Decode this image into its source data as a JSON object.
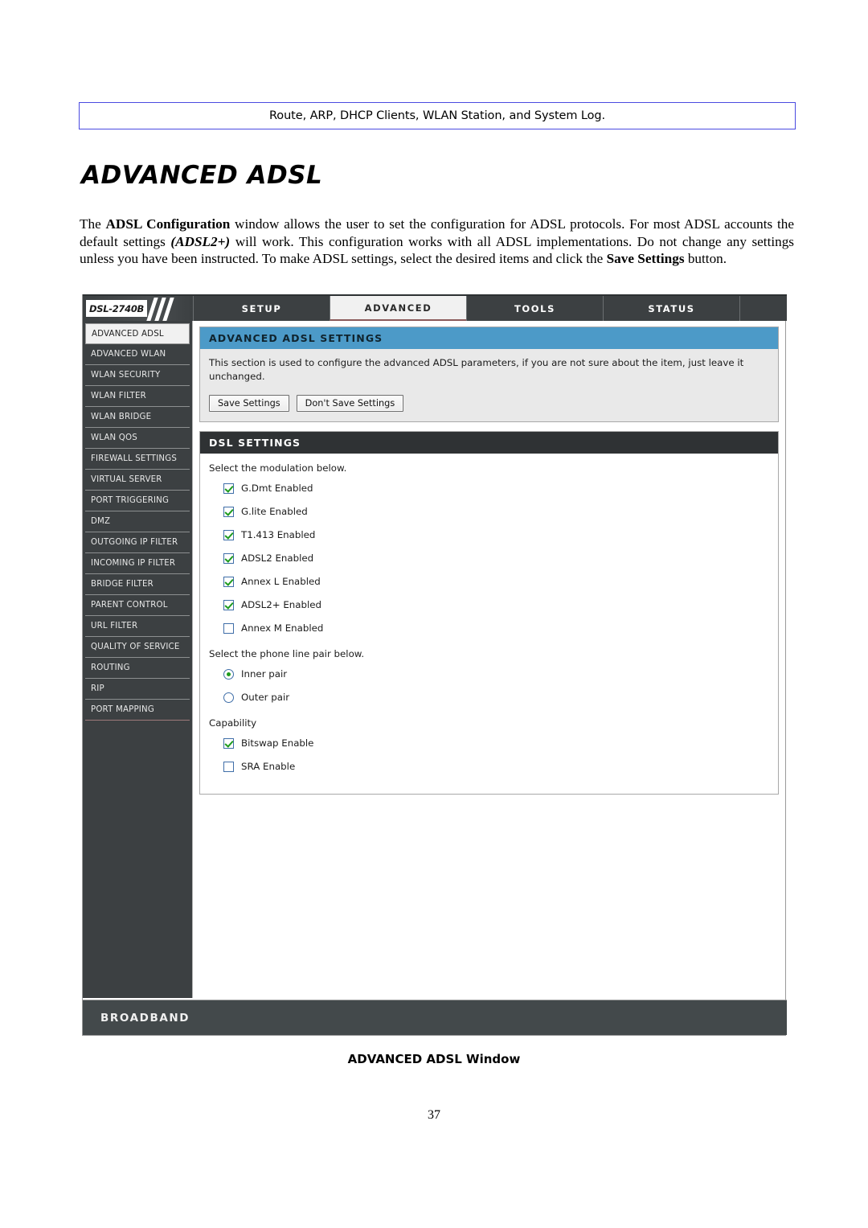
{
  "document": {
    "running_head": "Route, ARP, DHCP Clients, WLAN Station, and System Log.",
    "title": "ADVANCED ADSL",
    "paragraph_parts": {
      "p1": "The ",
      "b1": "ADSL Configuration",
      "p2": " window allows the user to set the configuration for ADSL protocols. For most ADSL accounts the default settings ",
      "i1": "(ADSL2+)",
      "p3": " will work. This configuration works with all ADSL implementations. Do not change any settings unless you have been instructed. To make ADSL settings, select the desired items and click the ",
      "b2": "Save Settings",
      "p4": " button."
    },
    "figure_caption": "ADVANCED ADSL Window",
    "page_number": "37"
  },
  "router_ui": {
    "logo": "DSL-2740B",
    "nav_tabs": [
      {
        "label": "SETUP",
        "active": false
      },
      {
        "label": "ADVANCED",
        "active": true
      },
      {
        "label": "TOOLS",
        "active": false
      },
      {
        "label": "STATUS",
        "active": false
      }
    ],
    "sidebar": {
      "items": [
        {
          "label": "ADVANCED ADSL",
          "active": true
        },
        {
          "label": "ADVANCED WLAN",
          "active": false
        },
        {
          "label": "WLAN SECURITY",
          "active": false
        },
        {
          "label": "WLAN FILTER",
          "active": false
        },
        {
          "label": "WLAN BRIDGE",
          "active": false
        },
        {
          "label": "WLAN QOS",
          "active": false
        },
        {
          "label": "FIREWALL SETTINGS",
          "active": false
        },
        {
          "label": "VIRTUAL SERVER",
          "active": false
        },
        {
          "label": "PORT TRIGGERING",
          "active": false
        },
        {
          "label": "DMZ",
          "active": false
        },
        {
          "label": "OUTGOING IP FILTER",
          "active": false
        },
        {
          "label": "INCOMING IP FILTER",
          "active": false
        },
        {
          "label": "BRIDGE FILTER",
          "active": false
        },
        {
          "label": "PARENT CONTROL",
          "active": false
        },
        {
          "label": "URL FILTER",
          "active": false
        },
        {
          "label": "QUALITY OF SERVICE",
          "active": false
        },
        {
          "label": "ROUTING",
          "active": false
        },
        {
          "label": "RIP",
          "active": false
        },
        {
          "label": "PORT MAPPING",
          "active": false
        }
      ]
    },
    "settings_panel": {
      "header": "ADVANCED ADSL SETTINGS",
      "description": "This section is used to configure the advanced ADSL parameters, if you are not sure about the item, just leave it unchanged.",
      "save_button": "Save Settings",
      "dont_save_button": "Don't Save Settings"
    },
    "dsl_panel": {
      "header": "DSL SETTINGS",
      "modulation_label": "Select the modulation below.",
      "modulation_options": [
        {
          "label": "G.Dmt Enabled",
          "checked": true
        },
        {
          "label": "G.lite Enabled",
          "checked": true
        },
        {
          "label": "T1.413 Enabled",
          "checked": true
        },
        {
          "label": "ADSL2 Enabled",
          "checked": true
        },
        {
          "label": "Annex L Enabled",
          "checked": true
        },
        {
          "label": "ADSL2+ Enabled",
          "checked": true
        },
        {
          "label": "Annex M Enabled",
          "checked": false
        }
      ],
      "pair_label": "Select the phone line pair below.",
      "pair_options": [
        {
          "label": "Inner pair",
          "selected": true
        },
        {
          "label": "Outer pair",
          "selected": false
        }
      ],
      "capability_label": "Capability",
      "capability_options": [
        {
          "label": "Bitswap Enable",
          "checked": true
        },
        {
          "label": "SRA Enable",
          "checked": false
        }
      ]
    },
    "footer": "BROADBAND"
  },
  "colors": {
    "nav_dark": "#3c4042",
    "panel_blue": "#4c9ac8",
    "panel_dark": "#2f3234",
    "check_green": "#1e9b1e",
    "box_blue": "#3f6ea8",
    "head_border": "#4a4ae0"
  }
}
